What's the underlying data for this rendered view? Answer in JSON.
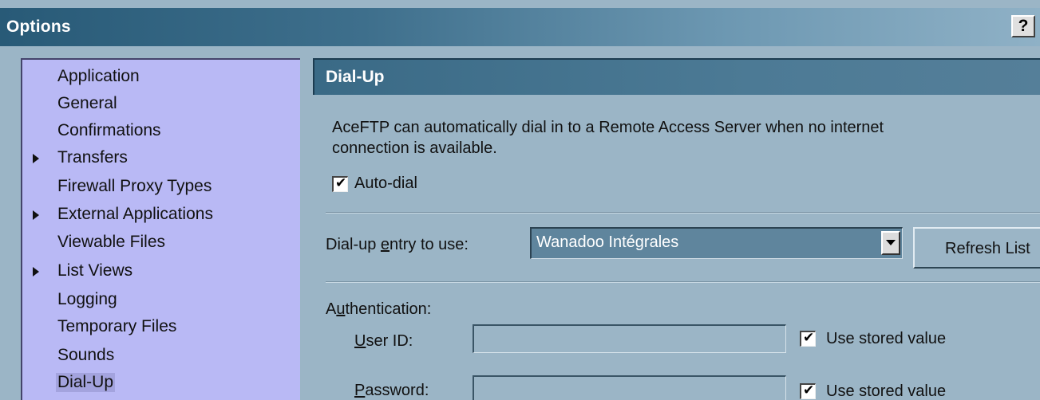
{
  "window": {
    "title": "Options",
    "help_label": "?"
  },
  "nav": {
    "items": [
      {
        "label": "Application",
        "expandable": false
      },
      {
        "label": "General",
        "expandable": false
      },
      {
        "label": "Confirmations",
        "expandable": false
      },
      {
        "label": "Transfers",
        "expandable": true
      },
      {
        "label": "Firewall Proxy Types",
        "expandable": false
      },
      {
        "label": "External Applications",
        "expandable": true
      },
      {
        "label": "Viewable Files",
        "expandable": false
      },
      {
        "label": "List Views",
        "expandable": true
      },
      {
        "label": "Logging",
        "expandable": false
      },
      {
        "label": "Temporary Files",
        "expandable": false
      },
      {
        "label": "Sounds",
        "expandable": false
      },
      {
        "label": "Dial-Up",
        "expandable": false,
        "selected": true
      }
    ]
  },
  "panel": {
    "title": "Dial-Up",
    "description_line1": "AceFTP can automatically dial in to a Remote Access Server when no internet",
    "description_line2": "connection is available.",
    "auto_dial": {
      "label": "Auto-dial",
      "checked": true
    },
    "dialup_entry": {
      "label_pre": "Dial-up ",
      "label_mnemonic": "e",
      "label_post": "ntry to use:",
      "selected_value": "Wanadoo Intégrales"
    },
    "refresh_button": "Refresh List",
    "authentication": {
      "label_pre": "A",
      "label_mnemonic": "u",
      "label_post": "thentication:",
      "user_id": {
        "label_mnemonic": "U",
        "label_post": "ser ID:",
        "value": "",
        "use_stored_label": "Use stored value",
        "use_stored_checked": true
      },
      "password": {
        "label_mnemonic": "P",
        "label_post": "assword:",
        "value": "",
        "use_stored_label": "Use stored value",
        "use_stored_checked": true
      }
    }
  },
  "colors": {
    "background": "#9bb5c6",
    "nav_background": "#b9b9f5",
    "header_blue": "#3a6a86"
  }
}
